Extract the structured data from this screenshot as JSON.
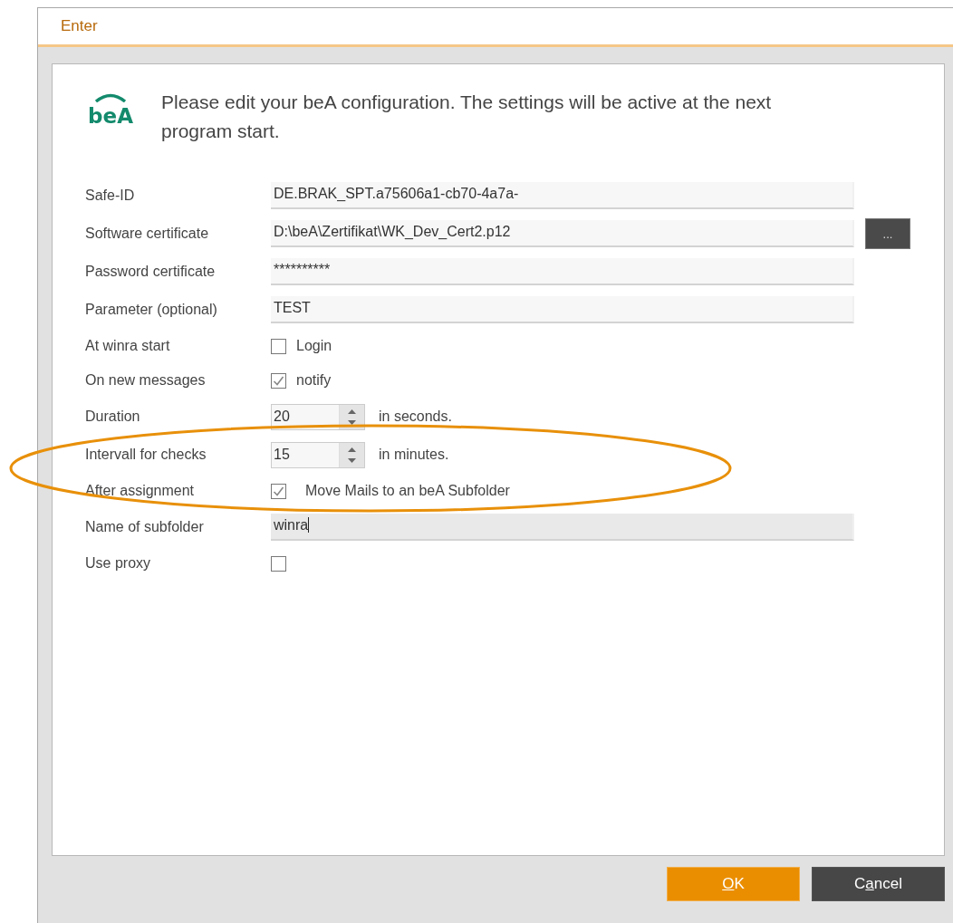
{
  "window": {
    "title": "Enter"
  },
  "header": {
    "logo_text": "beA",
    "message": "Please edit your beA configuration. The settings will be active at the next program start."
  },
  "rows": [
    {
      "kind": "text",
      "label": "Safe-ID",
      "value": "DE.BRAK_SPT.a75606a1-cb70-4a7a-"
    },
    {
      "kind": "text",
      "label": "Software certificate",
      "value": "D:\\beA\\Zertifikat\\WK_Dev_Cert2.p12",
      "browse": "..."
    },
    {
      "kind": "text",
      "label": "Password certificate",
      "value": "**********"
    },
    {
      "kind": "text",
      "label": "Parameter (optional)",
      "value": "TEST"
    },
    {
      "kind": "checkbox",
      "label": "At winra start",
      "checked": false,
      "text": "Login"
    },
    {
      "kind": "checkbox",
      "label": "On new messages",
      "checked": true,
      "text": "notify"
    },
    {
      "kind": "spinner",
      "label": "Duration",
      "value": "20",
      "unit": "in seconds."
    },
    {
      "kind": "spinner",
      "label": "Intervall for checks",
      "value": "15",
      "unit": "in minutes."
    },
    {
      "kind": "checkbox",
      "label": "After assignment",
      "checked": true,
      "text": "Move Mails to an beA Subfolder"
    },
    {
      "kind": "text",
      "label": "Name of subfolder",
      "value": "winra",
      "focused": true
    },
    {
      "kind": "checkbox",
      "label": "Use proxy",
      "checked": false
    }
  ],
  "buttons": [
    {
      "kind": "primary",
      "key": "O",
      "rest": "K"
    },
    {
      "kind": "secondary",
      "start": "C",
      "key": "a",
      "rest": "ncel"
    }
  ],
  "annotations": [
    {
      "kind": "ellipse"
    }
  ]
}
